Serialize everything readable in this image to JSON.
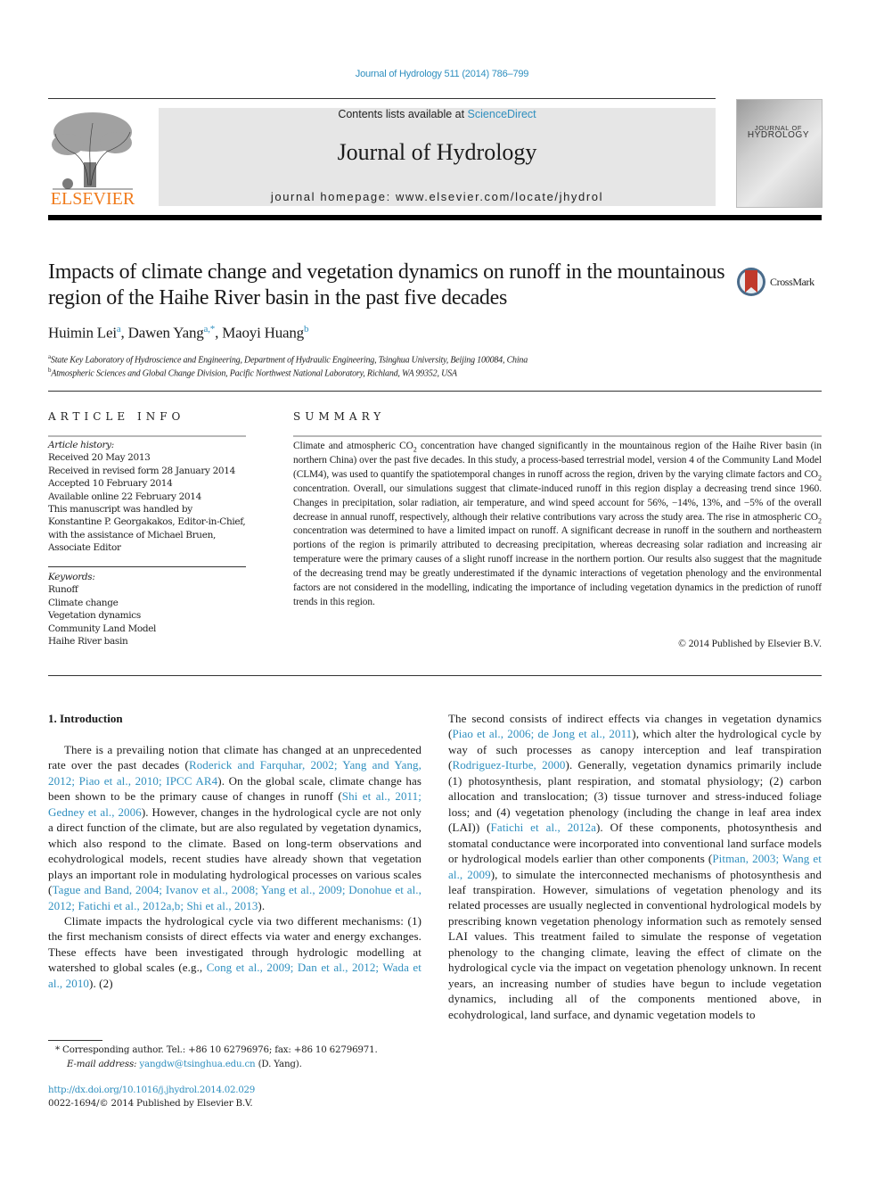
{
  "header": {
    "citation": "Journal of Hydrology 511 (2014) 786–799",
    "contents_prefix": "Contents lists available at ",
    "contents_link": "ScienceDirect",
    "journal_title": "Journal of Hydrology",
    "homepage": "journal homepage: www.elsevier.com/locate/jhydrol",
    "publisher_logo_text": "ELSEVIER",
    "cover_text_line1": "JOURNAL OF",
    "cover_text_line2": "HYDROLOGY",
    "crossmark_label": "CrossMark"
  },
  "article": {
    "title": "Impacts of climate change and vegetation dynamics on runoff in the mountainous region of the Haihe River basin in the past five decades",
    "authors": [
      {
        "name": "Huimin Lei",
        "sup": "a"
      },
      {
        "name": "Dawen Yang",
        "sup": "a,*"
      },
      {
        "name": "Maoyi Huang",
        "sup": "b"
      }
    ],
    "affiliations": [
      {
        "sup": "a",
        "text": "State Key Laboratory of Hydroscience and Engineering, Department of Hydraulic Engineering, Tsinghua University, Beijing 100084, China"
      },
      {
        "sup": "b",
        "text": "Atmospheric Sciences and Global Change Division, Pacific Northwest National Laboratory, Richland, WA 99352, USA"
      }
    ]
  },
  "article_info": {
    "heading": "ARTICLE INFO",
    "history_label": "Article history:",
    "history": [
      "Received 20 May 2013",
      "Received in revised form 28 January 2014",
      "Accepted 10 February 2014",
      "Available online 22 February 2014",
      "This manuscript was handled by",
      "Konstantine P. Georgakakos, Editor-in-Chief,",
      "with the assistance of Michael Bruen,",
      "Associate Editor"
    ],
    "keywords_label": "Keywords:",
    "keywords": [
      "Runoff",
      "Climate change",
      "Vegetation dynamics",
      "Community Land Model",
      "Haihe River basin"
    ]
  },
  "summary": {
    "heading": "SUMMARY",
    "parts": [
      "Climate and atmospheric CO",
      "2",
      " concentration have changed significantly in the mountainous region of the Haihe River basin (in northern China) over the past five decades. In this study, a process-based terrestrial model, version 4 of the Community Land Model (CLM4), was used to quantify the spatiotemporal changes in runoff across the region, driven by the varying climate factors and CO",
      "2",
      " concentration. Overall, our simulations suggest that climate-induced runoff in this region display a decreasing trend since 1960. Changes in precipitation, solar radiation, air temperature, and wind speed account for 56%, −14%, 13%, and −5% of the overall decrease in annual runoff, respectively, although their relative contributions vary across the study area. The rise in atmospheric CO",
      "2",
      " concentration was determined to have a limited impact on runoff. A significant decrease in runoff in the southern and northeastern portions of the region is primarily attributed to decreasing precipitation, whereas decreasing solar radiation and increasing air temperature were the primary causes of a slight runoff increase in the northern portion. Our results also suggest that the magnitude of the decreasing trend may be greatly underestimated if the dynamic interactions of vegetation phenology and the environmental factors are not considered in the modelling, indicating the importance of including vegetation dynamics in the prediction of runoff trends in this region."
    ],
    "copyright": "© 2014 Published by Elsevier B.V."
  },
  "body": {
    "intro_heading": "1. Introduction",
    "left_p1": [
      {
        "t": "There is a prevailing notion that climate has changed at an unprecedented rate over the past decades ("
      },
      {
        "l": "Roderick and Farquhar, 2002; Yang and Yang, 2012; Piao et al., 2010; IPCC AR4"
      },
      {
        "t": "). On the global scale, climate change has been shown to be the primary cause of changes in runoff ("
      },
      {
        "l": "Shi et al., 2011; Gedney et al., 2006"
      },
      {
        "t": "). However, changes in the hydrological cycle are not only a direct function of the climate, but are also regulated by vegetation dynamics, which also respond to the climate. Based on long-term observations and ecohydrological models, recent studies have already shown that vegetation plays an important role in modulating hydrological processes on various scales ("
      },
      {
        "l": "Tague and Band, 2004; Ivanov et al., 2008; Yang et al., 2009; Donohue et al., 2012; Fatichi et al., 2012a,b; Shi et al., 2013"
      },
      {
        "t": ")."
      }
    ],
    "left_p2": [
      {
        "t": "Climate impacts the hydrological cycle via two different mechanisms: (1) the first mechanism consists of direct effects via water and energy exchanges. These effects have been investigated through hydrologic modelling at watershed to global scales (e.g., "
      },
      {
        "l": "Cong et al., 2009; Dan et al., 2012; Wada et al., 2010"
      },
      {
        "t": "). (2)"
      }
    ],
    "right_p1": [
      {
        "t": "The second consists of indirect effects via changes in vegetation dynamics ("
      },
      {
        "l": "Piao et al., 2006; de Jong et al., 2011"
      },
      {
        "t": "), which alter the hydrological cycle by way of such processes as canopy interception and leaf transpiration ("
      },
      {
        "l": "Rodriguez-Iturbe, 2000"
      },
      {
        "t": "). Generally, vegetation dynamics primarily include (1) photosynthesis, plant respiration, and stomatal physiology; (2) carbon allocation and translocation; (3) tissue turnover and stress-induced foliage loss; and (4) vegetation phenology (including the change in leaf area index (LAI)) ("
      },
      {
        "l": "Fatichi et al., 2012a"
      },
      {
        "t": "). Of these components, photosynthesis and stomatal conductance were incorporated into conventional land surface models or hydrological models earlier than other components ("
      },
      {
        "l": "Pitman, 2003; Wang et al., 2009"
      },
      {
        "t": "), to simulate the interconnected mechanisms of photosynthesis and leaf transpiration. However, simulations of vegetation phenology and its related processes are usually neglected in conventional hydrological models by prescribing known vegetation phenology information such as remotely sensed LAI values. This treatment failed to simulate the response of vegetation phenology to the changing climate, leaving the effect of climate on the hydrological cycle via the impact on vegetation phenology unknown. In recent years, an increasing number of studies have begun to include vegetation dynamics, including all of the components mentioned above, in ecohydrological, land surface, and dynamic vegetation models to"
      }
    ]
  },
  "footnotes": {
    "corresponding": "* Corresponding author. Tel.: +86 10 62796976; fax: +86 10 62796971.",
    "email_label": "E-mail address: ",
    "email": "yangdw@tsinghua.edu.cn",
    "email_suffix": " (D. Yang).",
    "doi": "http://dx.doi.org/10.1016/j.jhydrol.2014.02.029",
    "issn": "0022-1694/© 2014 Published by Elsevier B.V."
  },
  "colors": {
    "link": "#2f8fbf",
    "elsevier_orange": "#f07a1a",
    "masthead_bg": "#e6e6e6",
    "crossmark_red": "#c0392b"
  }
}
